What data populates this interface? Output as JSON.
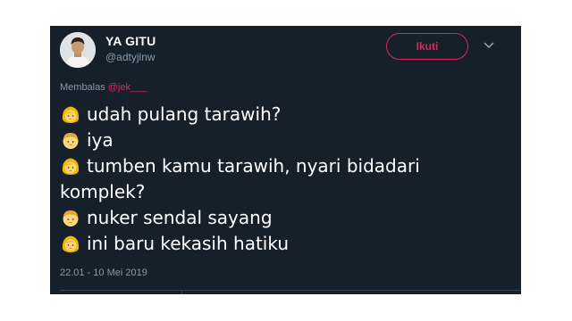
{
  "tweet": {
    "display_name": "YA GITU",
    "handle": "@adtyjlnw",
    "follow_label": "Ikuti",
    "reply_prefix": "Membalas",
    "reply_mention": "@jek___",
    "lines": [
      {
        "emoji": "girl-emoji",
        "text": "udah pulang tarawih?"
      },
      {
        "emoji": "boy-emoji",
        "text": "iya"
      },
      {
        "emoji": "girl-emoji",
        "text": "tumben kamu tarawih, nyari bidadari komplek?"
      },
      {
        "emoji": "boy-emoji",
        "text": "nuker sendal sayang"
      },
      {
        "emoji": "girl-emoji",
        "text": "ini baru kekasih hatiku"
      }
    ],
    "timestamp": "22.01 - 10 Mei 2019"
  },
  "colors": {
    "background": "#15202b",
    "text_primary": "#ffffff",
    "text_secondary": "#8899a6",
    "accent": "#e0245e",
    "divider": "#38444d"
  },
  "icons": {
    "chevron": "chevron-down-icon",
    "avatar": "avatar",
    "emoji_girl": "girl-emoji",
    "emoji_boy": "boy-emoji"
  }
}
